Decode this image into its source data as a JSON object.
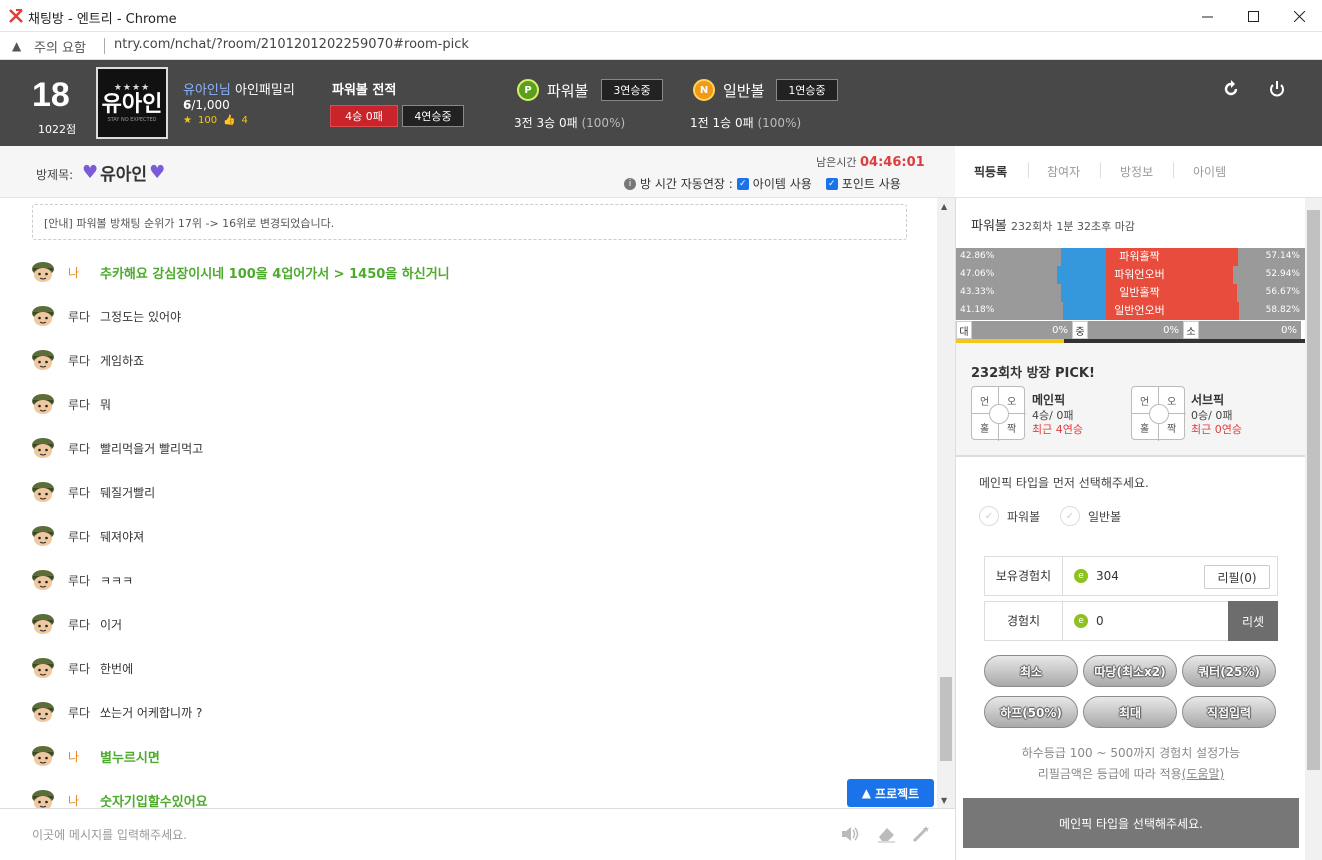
{
  "window": {
    "title": "채팅방 - 엔트리 - Chrome",
    "security_label": "주의 요함",
    "url": "ntry.com/nchat/?room/2101201202259070#room-pick"
  },
  "header": {
    "level": "18",
    "points": "1022점",
    "avatar": {
      "stars": "★★★★",
      "name": "유아인",
      "sub": "STAY NO EXPECTED"
    },
    "username": "유아인님",
    "family": "아인패밀리",
    "count_current": "6",
    "count_total": "/1,000",
    "star_count": "100",
    "like_count": "4",
    "powerball_record_title": "파워볼 전적",
    "powerball_record_result": "4승 0패",
    "powerball_record_streak": "4연승중",
    "powerball": {
      "label": "파워볼",
      "streak": "3연승중",
      "record": "3전 3승 0패",
      "pct": "(100%)"
    },
    "normalball": {
      "label": "일반볼",
      "streak": "1연승중",
      "record": "1전 1승 0패",
      "pct": "(100%)"
    }
  },
  "room": {
    "label": "방제목:",
    "name": "유아인",
    "remaining_label": "남은시간",
    "remaining_time": "04:46:01",
    "auto_extend_label": "방 시간 자동연장 :",
    "item_use": "아이템 사용",
    "point_use": "포인트 사용"
  },
  "tabs": [
    "픽등록",
    "참여자",
    "방정보",
    "아이템"
  ],
  "chat": {
    "notice": "[안내] 파워볼 방채팅 순위가 17위 -> 16위로 변경되었습니다.",
    "messages": [
      {
        "nick": "나",
        "text": "추카해요 강심장이시네 100을 4업어가서 > 1450을 하신거니",
        "me": true
      },
      {
        "nick": "루다",
        "text": "그정도는 있어야",
        "me": false
      },
      {
        "nick": "루다",
        "text": "게임하죠",
        "me": false
      },
      {
        "nick": "루다",
        "text": "뭐",
        "me": false
      },
      {
        "nick": "루다",
        "text": "빨리먹을거 빨리먹고",
        "me": false
      },
      {
        "nick": "루다",
        "text": "뒈질거빨리",
        "me": false
      },
      {
        "nick": "루다",
        "text": "뒈져야져",
        "me": false
      },
      {
        "nick": "루다",
        "text": "ㅋㅋㅋ",
        "me": false
      },
      {
        "nick": "루다",
        "text": "이거",
        "me": false
      },
      {
        "nick": "루다",
        "text": "한번에",
        "me": false
      },
      {
        "nick": "루다",
        "text": "쏘는거 어케합니까 ?",
        "me": false
      },
      {
        "nick": "나",
        "text": "별누르시면",
        "me": true
      },
      {
        "nick": "나",
        "text": "숫자기입할수있어요",
        "me": true
      }
    ],
    "project_button": "프로젝트",
    "input_placeholder": "이곳에 메시지를 입력해주세요."
  },
  "pick_panel": {
    "game": "파워볼",
    "round": "232회차",
    "deadline": "1분 32초후 마감",
    "stats": [
      {
        "label": "파워홀짝",
        "left": "42.86%",
        "right": "57.14%",
        "left_val": 42.86,
        "right_val": 57.14
      },
      {
        "label": "파워언오버",
        "left": "47.06%",
        "right": "52.94%",
        "left_val": 47.06,
        "right_val": 52.94
      },
      {
        "label": "일반홀짝",
        "left": "43.33%",
        "right": "56.67%",
        "left_val": 43.33,
        "right_val": 56.67
      },
      {
        "label": "일반언오버",
        "left": "41.18%",
        "right": "58.82%",
        "left_val": 41.18,
        "right_val": 58.82
      }
    ],
    "size_stats": [
      {
        "label": "대",
        "value": "0%"
      },
      {
        "label": "중",
        "value": "0%"
      },
      {
        "label": "소",
        "value": "0%"
      }
    ],
    "host_pick_title": "232회차 방장 PICK!",
    "wheel_labels": [
      "언",
      "오",
      "홀",
      "짝"
    ],
    "main_pick": {
      "name": "메인픽",
      "record": "4승/ 0패",
      "streak": "최근 4연승"
    },
    "sub_pick": {
      "name": "서브픽",
      "record": "0승/ 0패",
      "streak": "최근 0연승"
    },
    "guide": "메인픽 타입을 먼저 선택해주세요.",
    "choices": [
      "파워볼",
      "일반볼"
    ],
    "owned_exp_label": "보유경험치",
    "owned_exp_value": "304",
    "refill_label": "리필(0)",
    "exp_label": "경험치",
    "exp_value": "0",
    "reset_label": "리셋",
    "bet_buttons": [
      "최소",
      "따당(최소x2)",
      "쿼터(25%)",
      "하프(50%)",
      "최대",
      "직접입력"
    ],
    "note1": "하수등급 100 ~ 500까지 경험치 설정가능",
    "note2_prefix": "리필금액은 등급에 따라 적용",
    "note2_link": "(도움말)",
    "submit_label": "메인픽 타입을 선택해주세요."
  }
}
